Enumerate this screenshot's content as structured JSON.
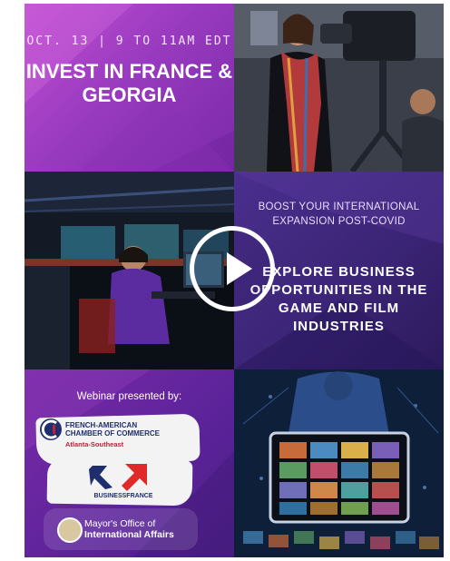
{
  "header": {
    "date": "OCT. 13 | 9 TO 11AM EDT",
    "headline": "INVEST IN FRANCE & GEORGIA"
  },
  "middle": {
    "boost": "BOOST YOUR INTERNATIONAL EXPANSION POST-COVID",
    "explore": "EXPLORE BUSINESS OPPORTUNITIES IN THE GAME AND FILM INDUSTRIES"
  },
  "footer": {
    "presented_by": "Webinar presented by:",
    "chamber_line1": "FRENCH-AMERICAN",
    "chamber_line2": "CHAMBER OF COMMERCE",
    "chamber_region": "Atlanta-Southeast",
    "businessfrance": "BUSINESSFRANCE",
    "mayor_line1": "Mayor's Office of",
    "mayor_line2": "International Affairs"
  },
  "video": {
    "play_icon": "play-icon"
  },
  "colors": {
    "purple": "#9a3bc0",
    "navy": "#1f2f6e",
    "red": "#c0203a"
  }
}
